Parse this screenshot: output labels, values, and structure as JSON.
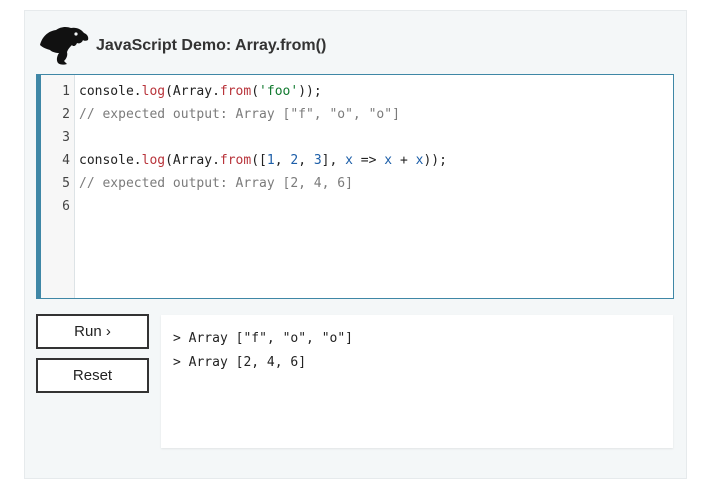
{
  "header": {
    "title": "JavaScript Demo: Array.from()",
    "logo_icon": "dinosaur-icon"
  },
  "editor": {
    "line_numbers": [
      "1",
      "2",
      "3",
      "4",
      "5",
      "6"
    ],
    "lines": [
      {
        "tokens": [
          {
            "t": "plain",
            "v": "console."
          },
          {
            "t": "fn",
            "v": "log"
          },
          {
            "t": "plain",
            "v": "(Array."
          },
          {
            "t": "fn",
            "v": "from"
          },
          {
            "t": "plain",
            "v": "("
          },
          {
            "t": "str",
            "v": "'foo'"
          },
          {
            "t": "plain",
            "v": "));"
          }
        ]
      },
      {
        "tokens": [
          {
            "t": "com",
            "v": "// expected output: Array [\"f\", \"o\", \"o\"]"
          }
        ]
      },
      {
        "tokens": []
      },
      {
        "tokens": [
          {
            "t": "plain",
            "v": "console."
          },
          {
            "t": "fn",
            "v": "log"
          },
          {
            "t": "plain",
            "v": "(Array."
          },
          {
            "t": "fn",
            "v": "from"
          },
          {
            "t": "plain",
            "v": "(["
          },
          {
            "t": "num",
            "v": "1"
          },
          {
            "t": "plain",
            "v": ", "
          },
          {
            "t": "num",
            "v": "2"
          },
          {
            "t": "plain",
            "v": ", "
          },
          {
            "t": "num",
            "v": "3"
          },
          {
            "t": "plain",
            "v": "], "
          },
          {
            "t": "param",
            "v": "x"
          },
          {
            "t": "plain",
            "v": " => "
          },
          {
            "t": "param",
            "v": "x"
          },
          {
            "t": "plain",
            "v": " + "
          },
          {
            "t": "param",
            "v": "x"
          },
          {
            "t": "plain",
            "v": "));"
          }
        ]
      },
      {
        "tokens": [
          {
            "t": "com",
            "v": "// expected output: Array [2, 4, 6]"
          }
        ]
      },
      {
        "tokens": []
      }
    ]
  },
  "buttons": {
    "run_label": "Run ›",
    "reset_label": "Reset"
  },
  "output": {
    "lines": [
      "> Array [\"f\", \"o\", \"o\"]",
      "> Array [2, 4, 6]"
    ]
  },
  "colors": {
    "accent": "#3f87a6",
    "keyword": "#b8333a",
    "string": "#117a2f",
    "number": "#1c5ea8",
    "comment": "#7b7b7b"
  }
}
